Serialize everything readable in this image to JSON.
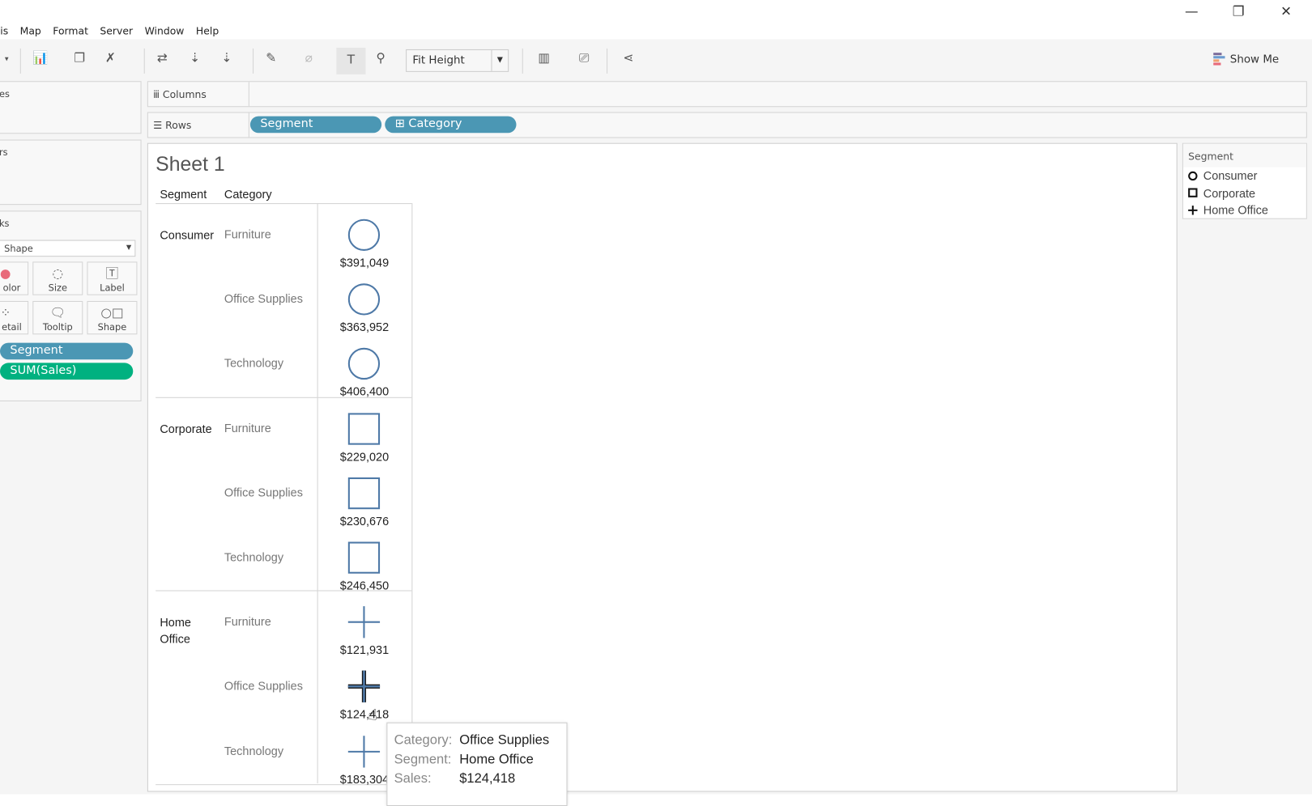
{
  "menu": [
    "sis",
    "Map",
    "Format",
    "Server",
    "Window",
    "Help"
  ],
  "window_controls": {
    "minimize": "minimize-icon",
    "restore": "restore-icon",
    "close": "close-icon"
  },
  "toolbar": {
    "fit_value": "Fit Height",
    "show_me": "Show Me"
  },
  "shelves": {
    "columns_label": "Columns",
    "rows_label": "Rows",
    "rows_pills": [
      "Segment",
      "⊞ Category"
    ]
  },
  "left_panel": {
    "pages_label": "es",
    "filters_label": "rs",
    "marks_label": "ks",
    "mark_type": "Shape",
    "mark_buttons": [
      "olor",
      "Size",
      "Label",
      "etail",
      "Tooltip",
      "Shape"
    ],
    "mark_pills": [
      "Segment",
      "SUM(Sales)"
    ]
  },
  "sheet": {
    "title": "Sheet 1",
    "headers": {
      "segment": "Segment",
      "category": "Category"
    },
    "segments": [
      {
        "name": "Consumer",
        "shape": "circle",
        "rows": [
          {
            "category": "Furniture",
            "sales": "$391,049"
          },
          {
            "category": "Office Supplies",
            "sales": "$363,952"
          },
          {
            "category": "Technology",
            "sales": "$406,400"
          }
        ]
      },
      {
        "name": "Corporate",
        "shape": "square",
        "rows": [
          {
            "category": "Furniture",
            "sales": "$229,020"
          },
          {
            "category": "Office Supplies",
            "sales": "$230,676"
          },
          {
            "category": "Technology",
            "sales": "$246,450"
          }
        ]
      },
      {
        "name": "Home Office",
        "shape": "plus",
        "rows": [
          {
            "category": "Furniture",
            "sales": "$121,931"
          },
          {
            "category": "Office Supplies",
            "sales": "$124,418"
          },
          {
            "category": "Technology",
            "sales": "$183,304"
          }
        ]
      }
    ],
    "mark_color": "#4e79a7"
  },
  "legend": {
    "title": "Segment",
    "items": [
      {
        "label": "Consumer",
        "shape": "circle"
      },
      {
        "label": "Corporate",
        "shape": "square"
      },
      {
        "label": "Home Office",
        "shape": "plus"
      }
    ]
  },
  "tooltip": {
    "rows": [
      {
        "key": "Category:",
        "value": "Office Supplies"
      },
      {
        "key": "Segment:",
        "value": "Home Office"
      },
      {
        "key": "Sales:",
        "value": "$124,418"
      }
    ]
  }
}
